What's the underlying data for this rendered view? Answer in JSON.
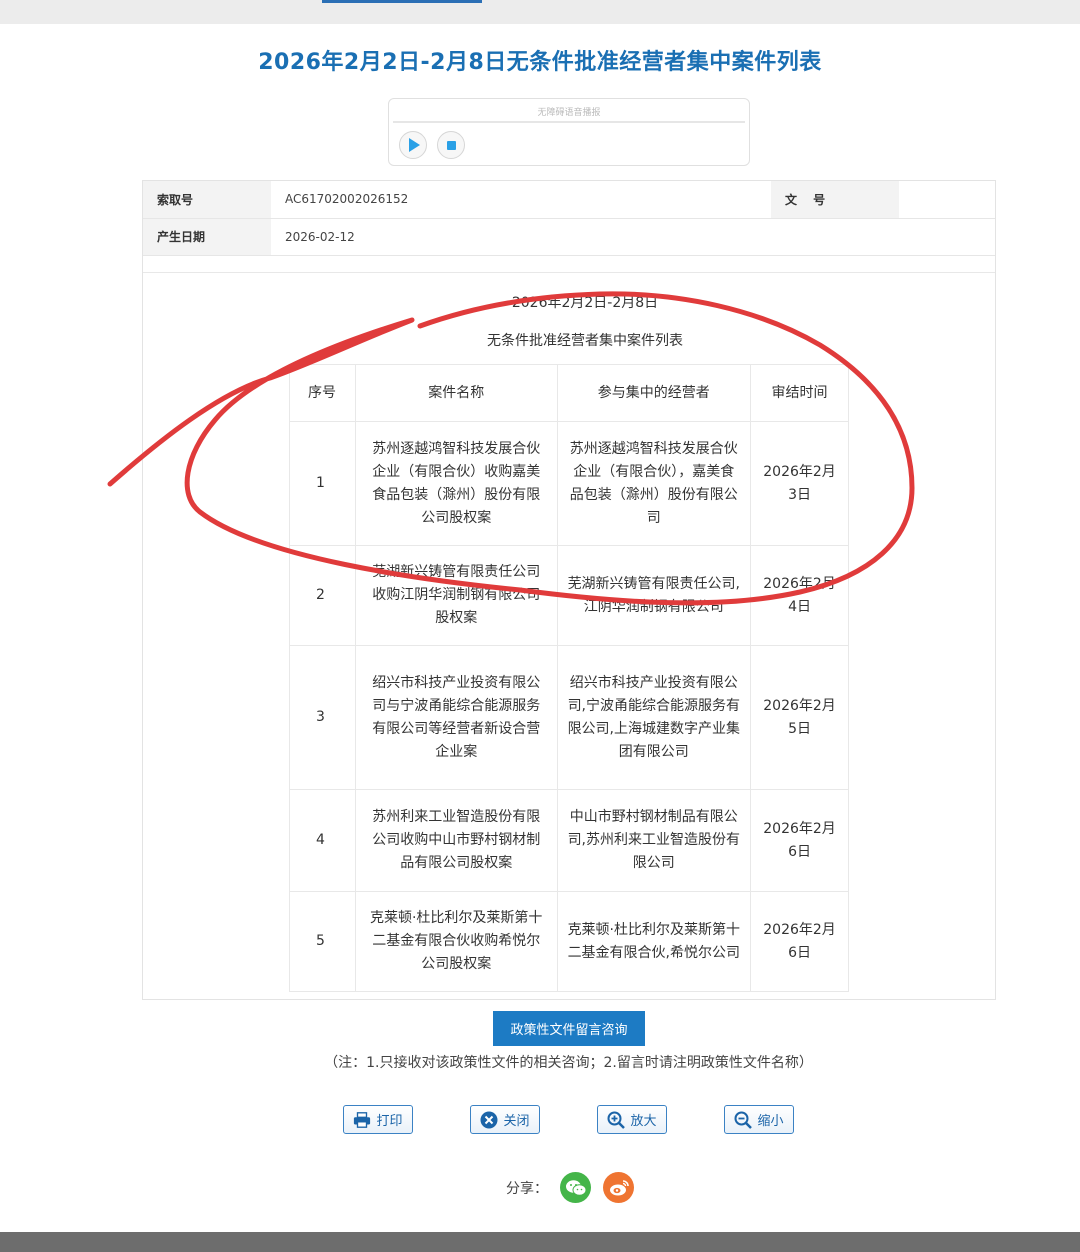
{
  "page": {
    "title": "2026年2月2日-2月8日无条件批准经营者集中案件列表"
  },
  "audio": {
    "label": "无障碍语音播报",
    "play_icon": "play-icon",
    "stop_icon": "stop-icon",
    "accent": "#2aa0e6"
  },
  "meta": {
    "index_label": "索取号",
    "index_value": "AC61702002026152",
    "doc_no_label": "文 号",
    "doc_no_value": "",
    "date_label": "产生日期",
    "date_value": "2026-02-12"
  },
  "content": {
    "subtitle1": "2026年2月2日-2月8日",
    "subtitle2": "无条件批准经营者集中案件列表",
    "headers": {
      "no": "序号",
      "name": "案件名称",
      "parties": "参与集中的经营者",
      "date": "审结时间"
    },
    "rows": [
      {
        "no": "1",
        "name": "苏州逐越鸿智科技发展合伙企业（有限合伙）收购嘉美食品包装（滁州）股份有限公司股权案",
        "parties": "苏州逐越鸿智科技发展合伙企业（有限合伙），嘉美食品包装（滁州）股份有限公司",
        "date": "2026年2月3日"
      },
      {
        "no": "2",
        "name": "芜湖新兴铸管有限责任公司收购江阴华润制钢有限公司股权案",
        "parties": "芜湖新兴铸管有限责任公司,江阴华润制钢有限公司",
        "date": "2026年2月4日"
      },
      {
        "no": "3",
        "name": "绍兴市科技产业投资有限公司与宁波甬能综合能源服务有限公司等经营者新设合营企业案",
        "parties": "绍兴市科技产业投资有限公司,宁波甬能综合能源服务有限公司,上海城建数字产业集团有限公司",
        "date": "2026年2月5日"
      },
      {
        "no": "4",
        "name": "苏州利来工业智造股份有限公司收购中山市野村钢材制品有限公司股权案",
        "parties": "中山市野村钢材制品有限公司,苏州利来工业智造股份有限公司",
        "date": "2026年2月6日"
      },
      {
        "no": "5",
        "name": "克莱顿·杜比利尔及莱斯第十二基金有限合伙收购希悦尔公司股权案",
        "parties": "克莱顿·杜比利尔及莱斯第十二基金有限合伙,希悦尔公司",
        "date": "2026年2月6日"
      }
    ]
  },
  "actions": {
    "consult_label": "政策性文件留言咨询",
    "note": "（注：1.只接收对该政策性文件的相关咨询；2.留言时请注明政策性文件名称）",
    "print_label": "打印",
    "close_label": "关闭",
    "zoom_in_label": "放大",
    "zoom_out_label": "缩小",
    "share_label": "分享：",
    "brand_color": "#1d7bc4"
  },
  "annotation": {
    "color": "#e03b3b"
  }
}
